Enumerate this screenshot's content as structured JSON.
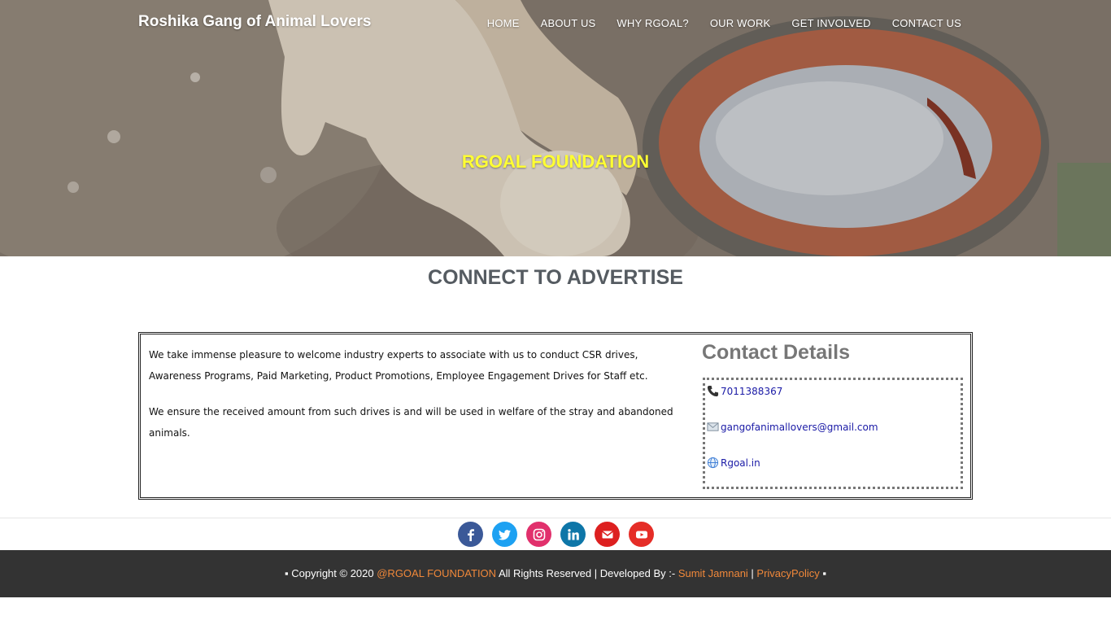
{
  "header": {
    "brand": "Roshika Gang of Animal Lovers",
    "nav": [
      "HOME",
      "ABOUT US",
      "WHY RGOAL?",
      "OUR WORK",
      "GET INVOLVED",
      "CONTACT US"
    ]
  },
  "hero": {
    "title": "RGOAL FOUNDATION"
  },
  "section": {
    "heading": "CONNECT TO ADVERTISE",
    "paragraphs": [
      "We take immense pleasure to welcome industry experts to associate with us to conduct CSR drives, Awareness Programs, Paid Marketing, Product Promotions, Employee Engagement Drives for Staff etc.",
      "We ensure the received amount from such drives is and will be used in welfare of the stray and abandoned animals."
    ]
  },
  "contact": {
    "title": "Contact Details",
    "phone": "7011388367",
    "email": "gangofanimallovers@gmail.com",
    "website": "Rgoal.in"
  },
  "social": [
    {
      "name": "facebook-icon",
      "color": "#3b5998"
    },
    {
      "name": "twitter-icon",
      "color": "#1da1f2"
    },
    {
      "name": "instagram-icon",
      "color": "#e1306c"
    },
    {
      "name": "linkedin-icon",
      "color": "#0e76a8"
    },
    {
      "name": "mail-icon",
      "color": "#dd2020"
    },
    {
      "name": "youtube-icon",
      "color": "#e52d27"
    }
  ],
  "footer": {
    "prefix": "▪ Copyright © 2020 ",
    "org": "@RGOAL FOUNDATION",
    "middle": " All Rights Reserved | Developed By :- ",
    "developer": "Sumit Jamnani",
    "sep": " | ",
    "privacy": "PrivacyPolicy",
    "suffix": " ▪"
  },
  "colors": {
    "hero_title": "#ffff33",
    "heading": "#555b61",
    "link": "#1a1aa6",
    "footer_bg": "#333333",
    "footer_accent": "#f0883a"
  }
}
